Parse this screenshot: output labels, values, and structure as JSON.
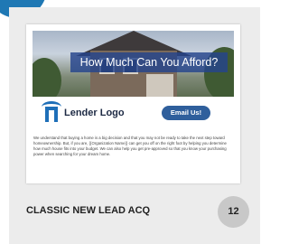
{
  "hero": {
    "title": "How Much Can You Afford?"
  },
  "email": {
    "logo_text": "Lender Logo",
    "cta_label": "Email Us!",
    "body": "We understand that buying a home is a big decision and that you may not be ready to take the next step toward homeownership. But, if you are, {{Organization Name}} can get you off on the right foot by helping you determine how much house fits into your budget. We can also help you get pre-approved so that you know your purchasing power when searching for your dream home."
  },
  "card": {
    "title": "CLASSIC NEW LEAD ACQ",
    "count": "12"
  },
  "colors": {
    "accent_blue": "#1f78b4",
    "banner_blue": "#24448c",
    "button_blue": "#2f5f9c",
    "card_bg": "#ececec",
    "badge_gray": "#c8c8c8"
  }
}
